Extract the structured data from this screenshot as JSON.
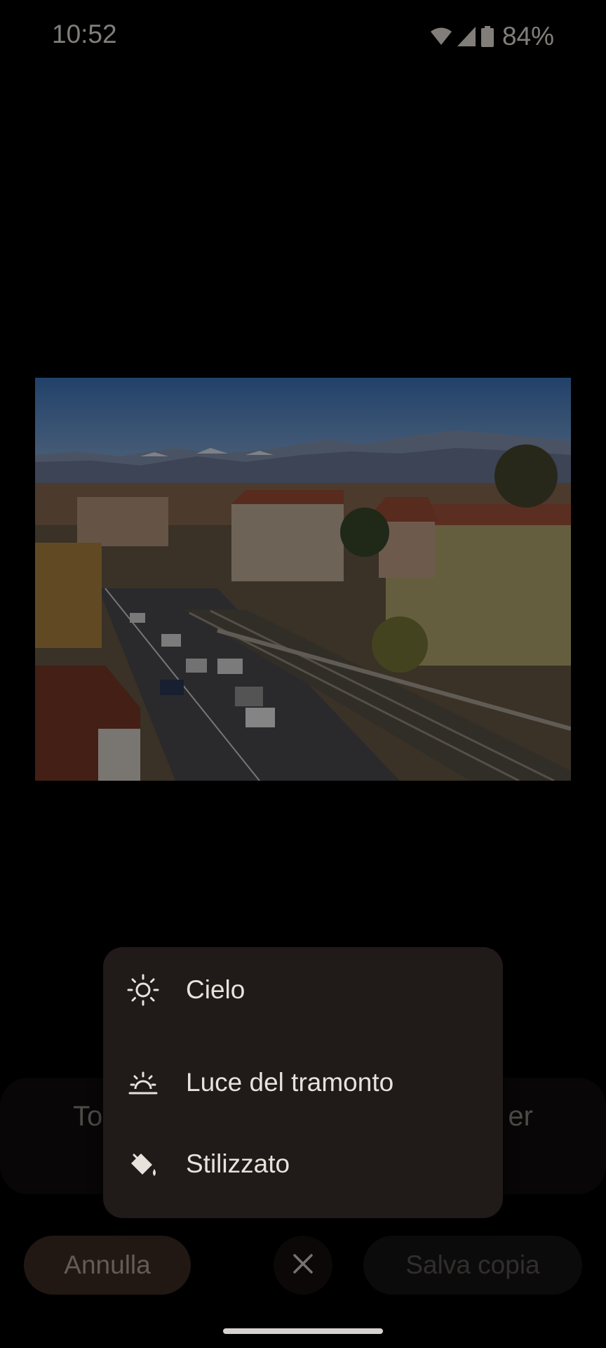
{
  "status_bar": {
    "time": "10:52",
    "battery_percent": "84%",
    "icons": [
      "wifi-icon",
      "cell-signal-icon",
      "battery-icon"
    ]
  },
  "suggestions_strip": {
    "left_text": "To",
    "right_text": "er"
  },
  "menu": {
    "items": [
      {
        "label": "Cielo",
        "icon": "sun-icon"
      },
      {
        "label": "Luce del tramonto",
        "icon": "sunset-icon"
      },
      {
        "label": "Stilizzato",
        "icon": "paint-bucket-icon"
      }
    ]
  },
  "bottom_bar": {
    "cancel_label": "Annulla",
    "close_icon": "close-icon",
    "save_label": "Salva copia"
  },
  "colors": {
    "background": "#000000",
    "menu_background": "#201a18",
    "cancel_button": "#3d2c24",
    "save_button_disabled": "#161414"
  }
}
